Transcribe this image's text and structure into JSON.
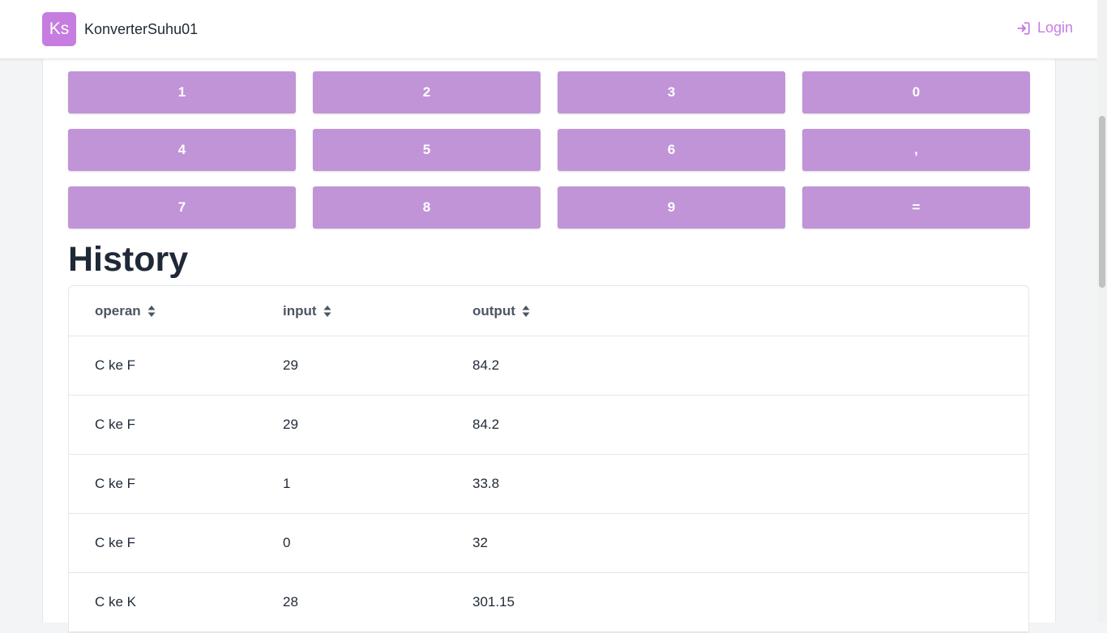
{
  "navbar": {
    "logo_text": "Ks",
    "brand_name": "KonverterSuhu01",
    "login_label": "Login",
    "accent_color": "#c77de0"
  },
  "keypad": {
    "keys": [
      "1",
      "2",
      "3",
      "0",
      "4",
      "5",
      "6",
      ",",
      "7",
      "8",
      "9",
      "="
    ],
    "key_color": "#c194d8"
  },
  "history": {
    "title": "History",
    "columns": [
      "operan",
      "input",
      "output"
    ],
    "rows": [
      {
        "operan": "C ke F",
        "input": "29",
        "output": "84.2"
      },
      {
        "operan": "C ke F",
        "input": "29",
        "output": "84.2"
      },
      {
        "operan": "C ke F",
        "input": "1",
        "output": "33.8"
      },
      {
        "operan": "C ke F",
        "input": "0",
        "output": "32"
      },
      {
        "operan": "C ke K",
        "input": "28",
        "output": "301.15"
      }
    ]
  }
}
